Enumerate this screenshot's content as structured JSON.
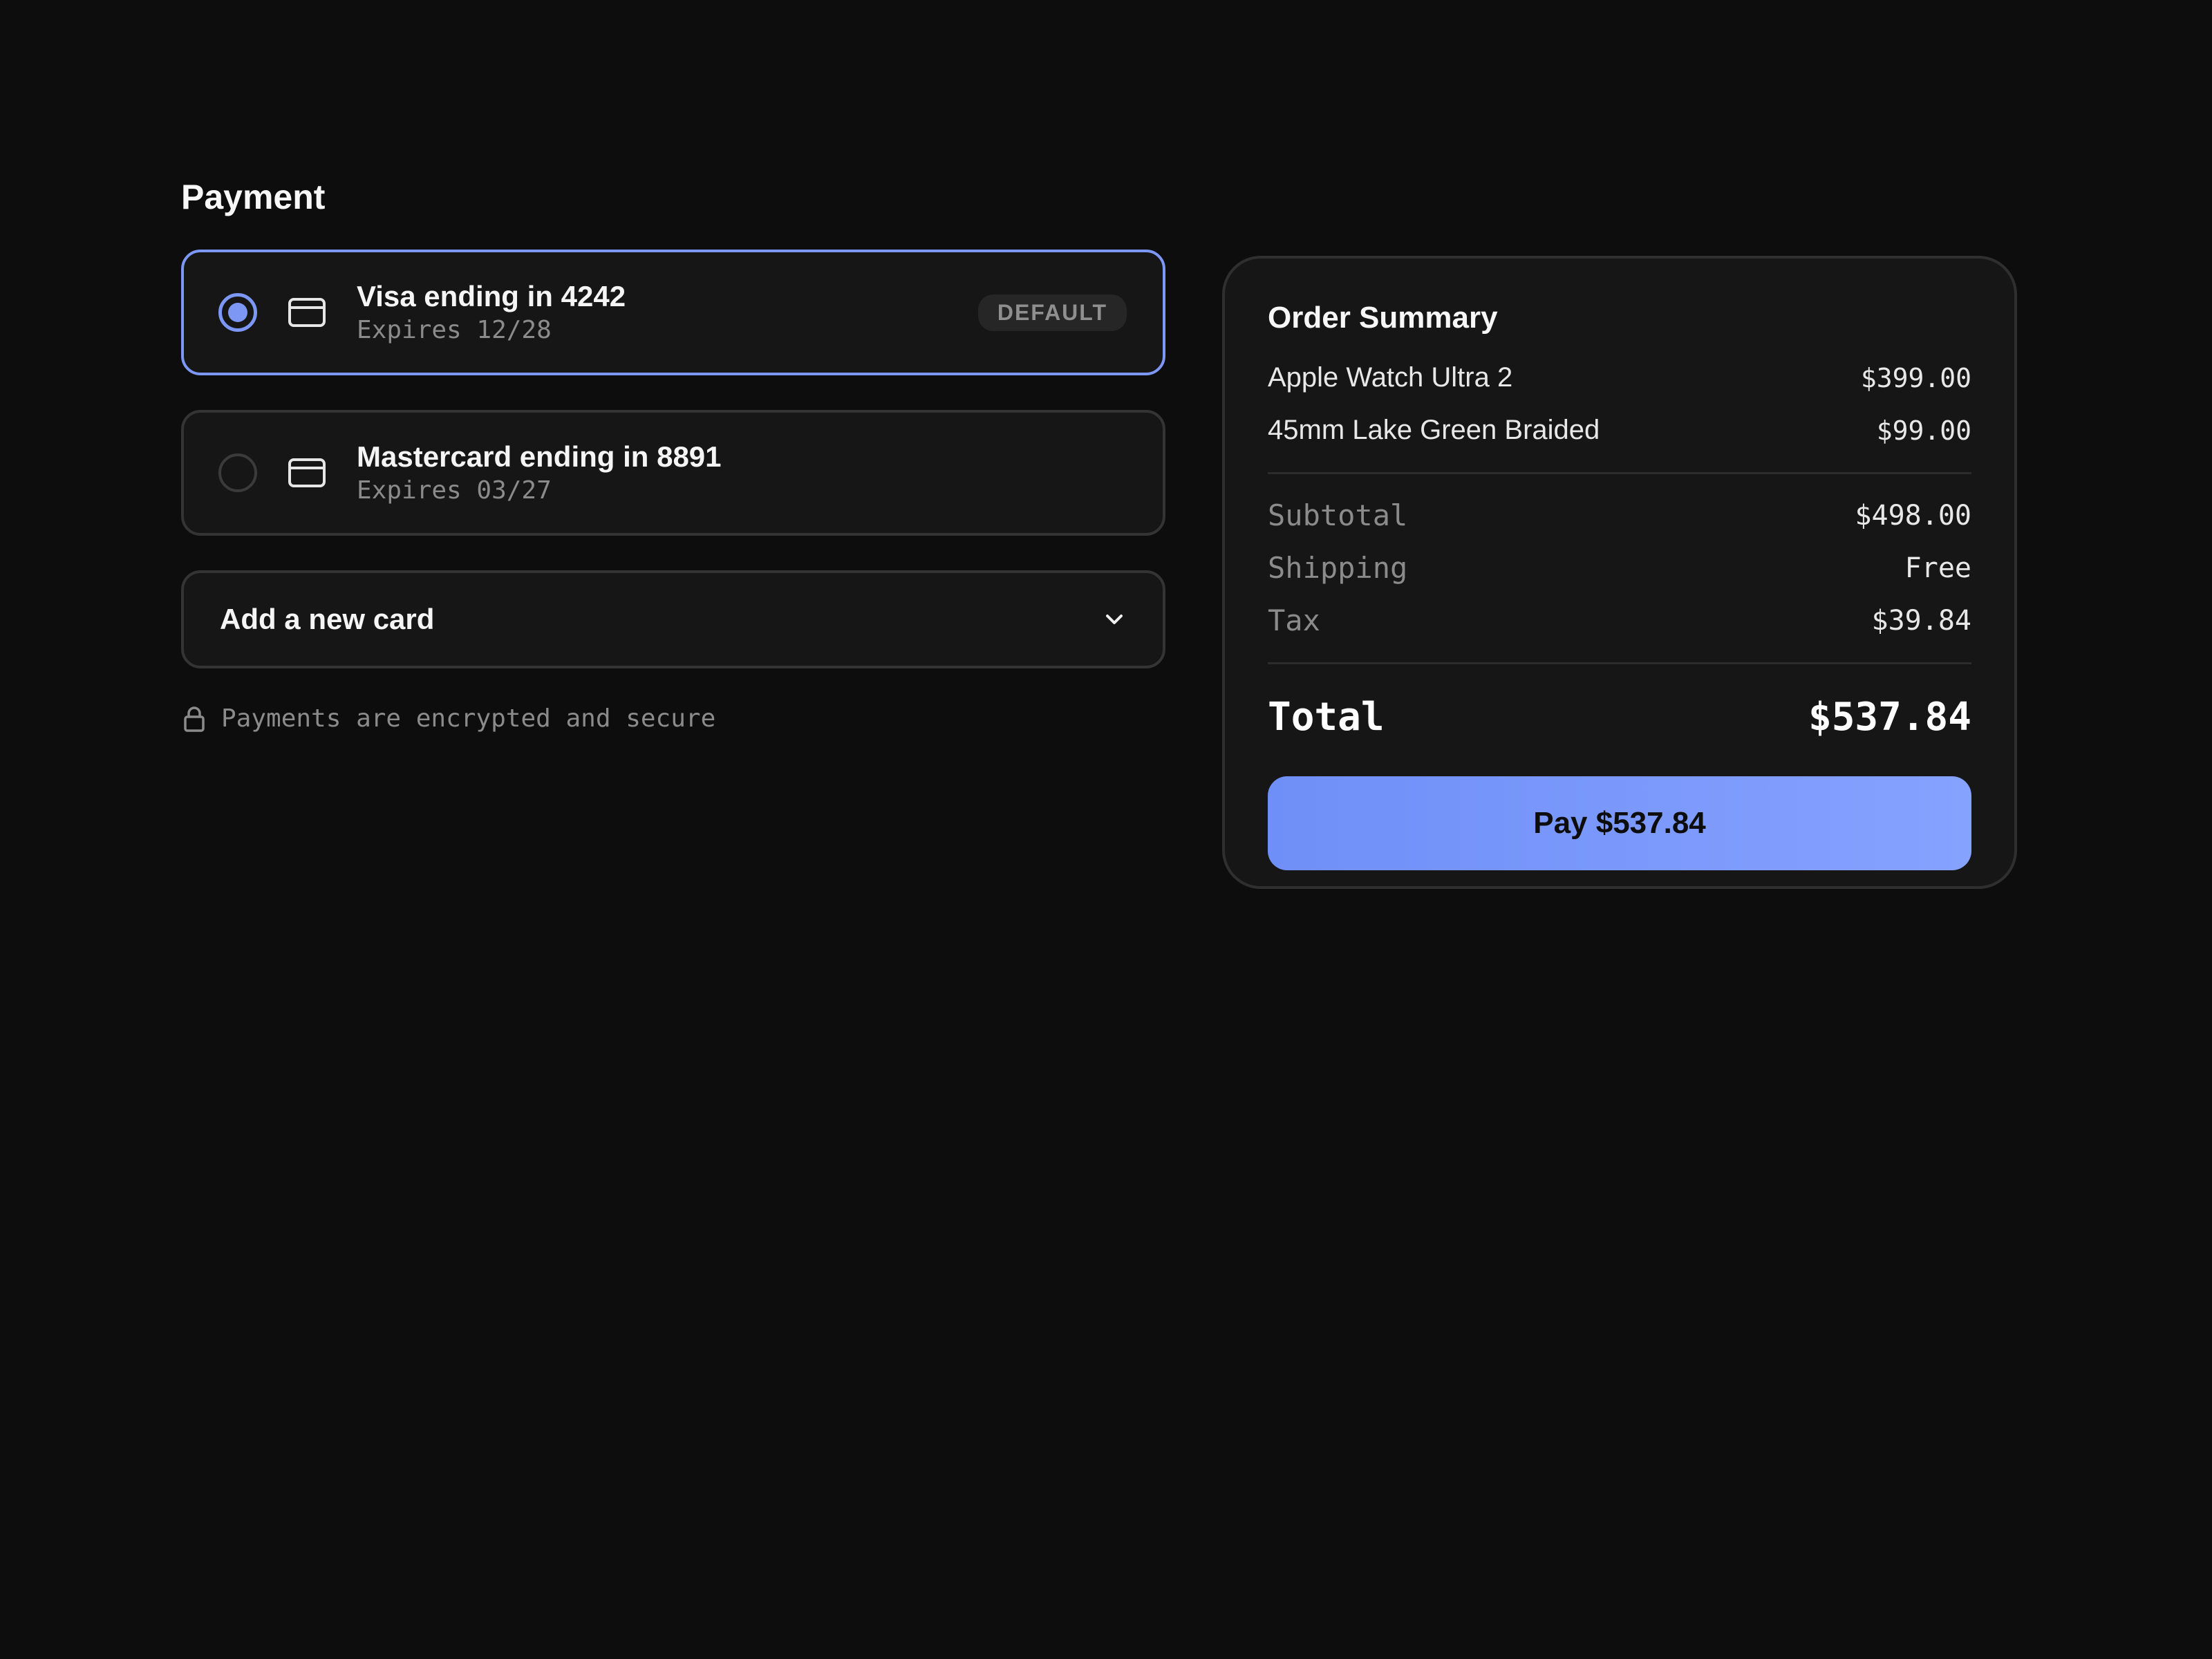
{
  "payment": {
    "title": "Payment",
    "cards": [
      {
        "name": "Visa ending in 4242",
        "expires": "Expires 12/28",
        "badge": "DEFAULT",
        "selected": true
      },
      {
        "name": "Mastercard ending in 8891",
        "expires": "Expires 03/27",
        "selected": false
      }
    ],
    "add_card_label": "Add a new card",
    "secure_note": "Payments are encrypted and secure"
  },
  "summary": {
    "title": "Order Summary",
    "items": [
      {
        "name": "Apple Watch Ultra 2",
        "price": "$399.00"
      },
      {
        "name": "45mm Lake Green Braided",
        "price": "$99.00"
      }
    ],
    "subtotal_label": "Subtotal",
    "subtotal_value": "$498.00",
    "shipping_label": "Shipping",
    "shipping_value": "Free",
    "tax_label": "Tax",
    "tax_value": "$39.84",
    "total_label": "Total",
    "total_value": "$537.84",
    "pay_button_label": "Pay $537.84"
  },
  "icons": {
    "radio_selected": "radio-selected-icon",
    "radio_unselected": "radio-unselected-icon",
    "card": "credit-card-icon",
    "chevron": "chevron-down-icon",
    "lock": "lock-icon"
  },
  "colors": {
    "background": "#0d0d0d",
    "panel": "#161616",
    "accent": "#7d97f4",
    "muted_text": "#8b8b8b"
  }
}
